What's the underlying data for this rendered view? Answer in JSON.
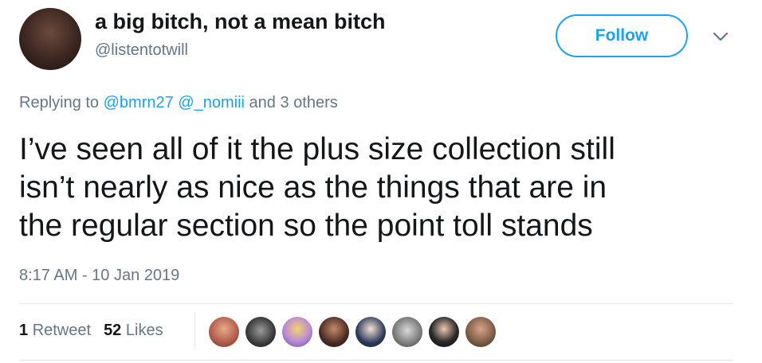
{
  "author": {
    "display_name": "a big bitch, not a mean bitch",
    "handle": "@listentotwill",
    "avatar_icon": "profile-photo"
  },
  "follow_label": "Follow",
  "menu_icon": "chevron-down-icon",
  "reply_context": {
    "prefix": "Replying to",
    "mention_1": "@bmrn27",
    "mention_2": "@_nomiii",
    "suffix": "and 3 others"
  },
  "tweet": {
    "lines": [
      "I’ve seen all of it the plus size collection still",
      "isn’t nearly as nice as the things that are in",
      "the regular section so the point toll stands"
    ],
    "timestamp": "8:17 AM - 10 Jan 2019"
  },
  "stats": {
    "retweets_count": "1",
    "retweets_label": "Retweet",
    "likes_count": "52",
    "likes_label": "Likes"
  },
  "likers_count_shown": 8,
  "colors": {
    "accent": "#1da1f2",
    "secondary_text": "#657786",
    "primary_text": "#14171a",
    "divider": "#e1e8ed"
  }
}
